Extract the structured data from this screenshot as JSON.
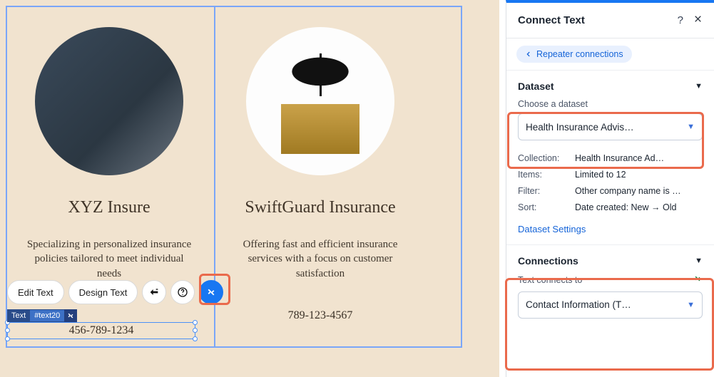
{
  "canvas": {
    "cards": [
      {
        "title": "XYZ Insure",
        "desc": "Specializing in personalized insurance policies tailored to meet individual needs",
        "phone": "456-789-1234"
      },
      {
        "title": "SwiftGuard Insurance",
        "desc": "Offering fast and efficient insurance services with a focus on customer satisfaction",
        "phone": "789-123-4567"
      }
    ],
    "selection": {
      "kind": "Text",
      "id": "#text20",
      "phone": "456-789-1234"
    },
    "toolbar": {
      "edit": "Edit Text",
      "design": "Design Text"
    }
  },
  "panel": {
    "title": "Connect Text",
    "breadcrumb": "Repeater connections",
    "dataset_section": "Dataset",
    "choose_label": "Choose a dataset",
    "dataset_value": "Health Insurance Advis…",
    "meta": {
      "collection_k": "Collection:",
      "collection_v": "Health Insurance Ad…",
      "items_k": "Items:",
      "items_v": "Limited to 12",
      "filter_k": "Filter:",
      "filter_v": "Other company name is …",
      "sort_k": "Sort:",
      "sort_v": "Date created: New → Old"
    },
    "settings_link": "Dataset Settings",
    "connections_section": "Connections",
    "text_connects_label": "Text connects to",
    "text_connects_value": "Contact Information (T…"
  }
}
